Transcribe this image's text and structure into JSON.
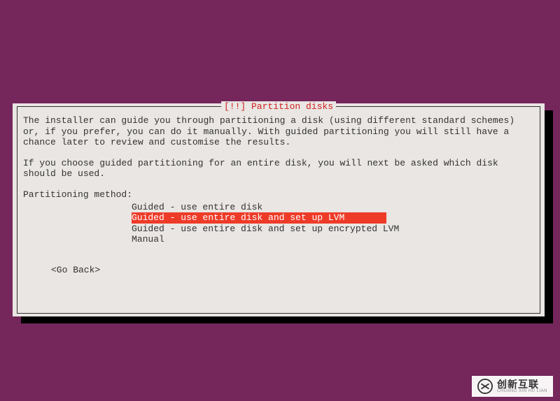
{
  "dialog": {
    "title": "[!!] Partition disks",
    "paragraph1": "The installer can guide you through partitioning a disk (using different standard schemes) or, if you prefer, you can do it manually. With guided partitioning you will still have a chance later to review and customise the results.",
    "paragraph2": "If you choose guided partitioning for an entire disk, you will next be asked which disk should be used.",
    "prompt": "Partitioning method:",
    "options": [
      {
        "label": "Guided - use entire disk",
        "selected": false
      },
      {
        "label": "Guided - use entire disk and set up LVM",
        "selected": true
      },
      {
        "label": "Guided - use entire disk and set up encrypted LVM",
        "selected": false
      },
      {
        "label": "Manual",
        "selected": false
      }
    ],
    "go_back": "<Go Back>"
  },
  "watermark": {
    "main": "创新互联",
    "sub": "CHUANG XIN HU LIAN"
  },
  "colors": {
    "background": "#75265b",
    "dialog_bg": "#e9e6e3",
    "title_color": "#d02020",
    "selected_bg": "#ee3b28"
  }
}
